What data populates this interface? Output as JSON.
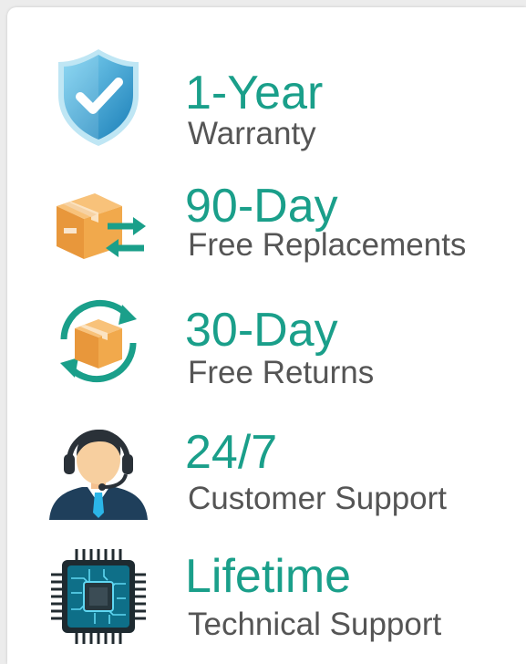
{
  "colors": {
    "accent": "#1a9f8a",
    "text": "#555555"
  },
  "features": [
    {
      "icon": "shield-check-icon",
      "title": "1-Year",
      "subtitle": "Warranty"
    },
    {
      "icon": "box-exchange-icon",
      "title": "90-Day",
      "subtitle": "Free Replacements"
    },
    {
      "icon": "box-return-icon",
      "title": "30-Day",
      "subtitle": "Free Returns"
    },
    {
      "icon": "headset-agent-icon",
      "title": "24/7",
      "subtitle": "Customer Support"
    },
    {
      "icon": "chip-icon",
      "title": "Lifetime",
      "subtitle": "Technical Support"
    }
  ]
}
